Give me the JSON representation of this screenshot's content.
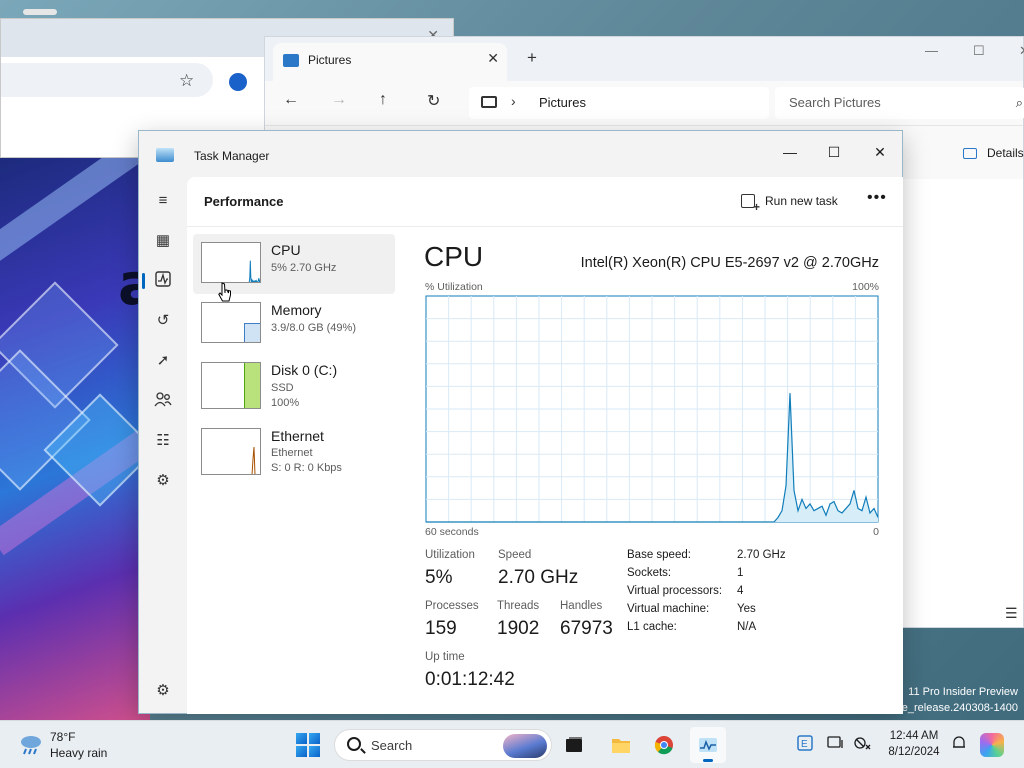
{
  "desktop": {
    "watermark_line1": "11 Pro Insider Preview",
    "watermark_line2": "e_release.240308-1400"
  },
  "explorer": {
    "tab_title": "Pictures",
    "address": "Pictures",
    "search_placeholder": "Search Pictures",
    "details_label": "Details"
  },
  "task_manager": {
    "title": "Task Manager",
    "page_title": "Performance",
    "run_new_task_label": "Run new task",
    "resources": [
      {
        "name": "CPU",
        "line1": "5% 2.70 GHz",
        "line2": ""
      },
      {
        "name": "Memory",
        "line1": "3.9/8.0 GB (49%)",
        "line2": ""
      },
      {
        "name": "Disk 0 (C:)",
        "line1": "SSD",
        "line2": "100%"
      },
      {
        "name": "Ethernet",
        "line1": "Ethernet",
        "line2": "S: 0 R: 0 Kbps"
      }
    ],
    "detail": {
      "heading": "CPU",
      "model": "Intel(R) Xeon(R) CPU E5-2697 v2 @ 2.70GHz",
      "y_label": "% Utilization",
      "y_max_label": "100%",
      "x_label": "60 seconds",
      "x_min_label": "0",
      "stats": {
        "utilization_label": "Utilization",
        "utilization": "5%",
        "speed_label": "Speed",
        "speed": "2.70 GHz",
        "processes_label": "Processes",
        "processes": "159",
        "threads_label": "Threads",
        "threads": "1902",
        "handles_label": "Handles",
        "handles": "67973",
        "uptime_label": "Up time",
        "uptime": "0:01:12:42"
      },
      "specs": [
        {
          "label": "Base speed:",
          "value": "2.70 GHz"
        },
        {
          "label": "Sockets:",
          "value": "1"
        },
        {
          "label": "Virtual processors:",
          "value": "4"
        },
        {
          "label": "Virtual machine:",
          "value": "Yes"
        },
        {
          "label": "L1 cache:",
          "value": "N/A"
        }
      ],
      "utilization_history": [
        0,
        0,
        0,
        0,
        0,
        0,
        0,
        0,
        0,
        0,
        0,
        0,
        0,
        0,
        0,
        0,
        0,
        0,
        0,
        0,
        0,
        0,
        0,
        0,
        0,
        0,
        0,
        0,
        0,
        0,
        0,
        0,
        0,
        0,
        0,
        0,
        0,
        0,
        0,
        0,
        0,
        0,
        0,
        0,
        0,
        0,
        0,
        0,
        0,
        0,
        0,
        0,
        0,
        0,
        0,
        0,
        0,
        0,
        0,
        0,
        0,
        0,
        0,
        0,
        0,
        0,
        0,
        0,
        0,
        0,
        0,
        0,
        0,
        0,
        0,
        0,
        0,
        0,
        0,
        0,
        0,
        0,
        0,
        0,
        0,
        0,
        0,
        0,
        2,
        5,
        16,
        57,
        14,
        5,
        10,
        6,
        8,
        5,
        6,
        7,
        3,
        8,
        9,
        5,
        4,
        6,
        8,
        14,
        6,
        5,
        11,
        4,
        6,
        2
      ]
    },
    "colors": {
      "cpu": "#117dbb",
      "cpu_fill": "#d7eef8",
      "memory": "#8b12ae",
      "disk": "#4da60c",
      "disk_fill": "#b9e27c",
      "ethernet": "#a74f01",
      "accent": "#0067c0"
    }
  },
  "taskbar": {
    "weather_temp": "78°F",
    "weather_desc": "Heavy rain",
    "search_placeholder": "Search",
    "time": "12:44 AM",
    "date": "8/12/2024"
  }
}
